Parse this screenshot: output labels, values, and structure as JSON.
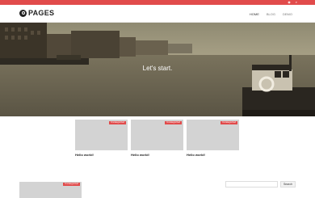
{
  "topbar": {
    "icons": [
      "rss-icon",
      "search-icon"
    ]
  },
  "header": {
    "logo_text": "PAGES",
    "nav": [
      {
        "label": "HOME",
        "active": true
      },
      {
        "label": "BLOG",
        "active": false
      },
      {
        "label": "DEMO",
        "active": false
      }
    ]
  },
  "hero": {
    "title": "Let's start."
  },
  "cards": [
    {
      "category": "Uncategorized",
      "title": "Hello world!"
    },
    {
      "category": "Uncategorized",
      "title": "Hello world!"
    },
    {
      "category": "Uncategorized",
      "title": "Hello world!"
    }
  ],
  "post": {
    "category": "Uncategorized"
  },
  "search": {
    "placeholder": "",
    "button_label": "Search"
  },
  "colors": {
    "accent": "#e14b4b",
    "placeholder_gray": "#d3d3d3"
  }
}
